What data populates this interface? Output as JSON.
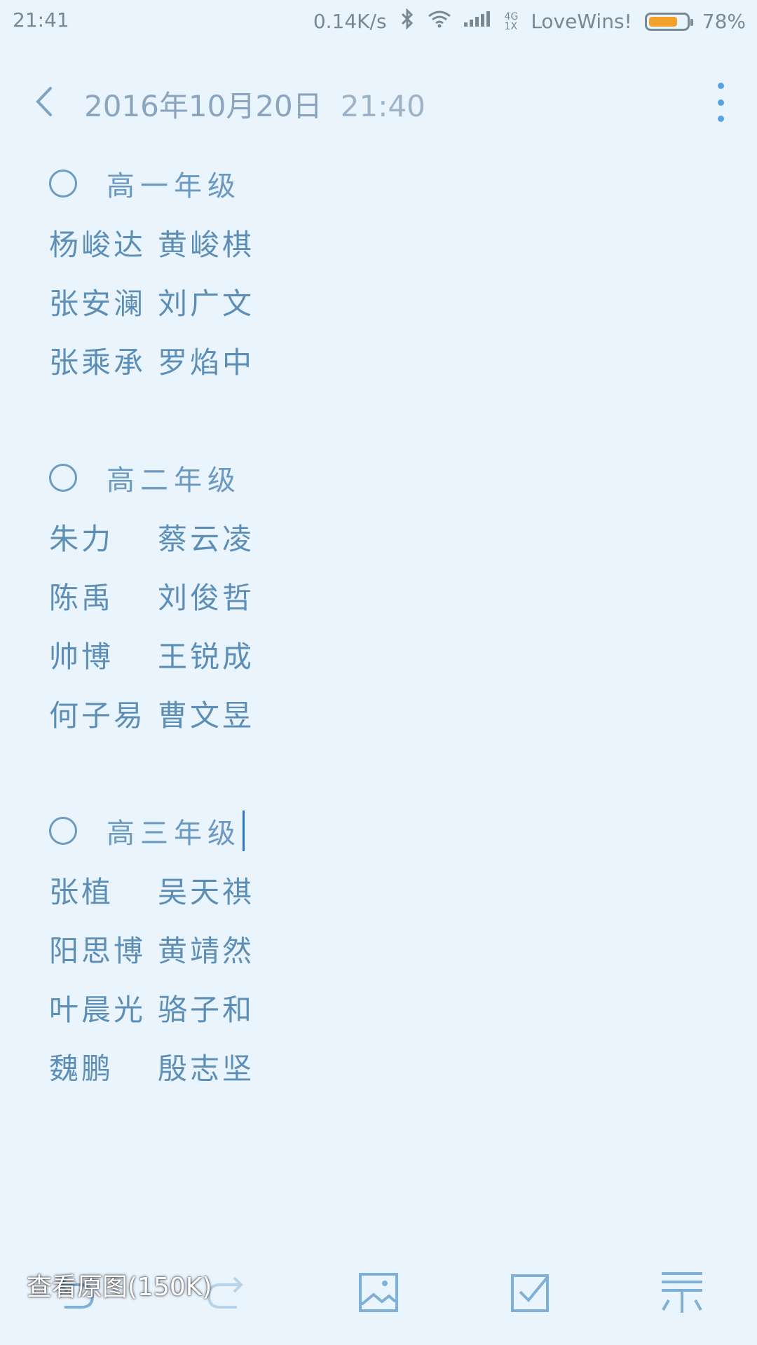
{
  "status_bar": {
    "time": "21:41",
    "speed": "0.14K/s",
    "network_top": "4G",
    "network_bottom": "1X",
    "carrier": "LoveWins!",
    "battery_percent": "78%",
    "battery_level": 0.78,
    "battery_color": "#f2a12b"
  },
  "header": {
    "date": "2016年10月20日",
    "time": "21:40"
  },
  "sections": [
    {
      "title": "高一年级",
      "rows": [
        [
          "杨峻达",
          "黄峻棋"
        ],
        [
          "张安澜",
          "刘广文"
        ],
        [
          "张乘承",
          "罗焰中"
        ]
      ]
    },
    {
      "title": "高二年级",
      "rows": [
        [
          "朱力",
          "蔡云凌"
        ],
        [
          "陈禹",
          "刘俊哲"
        ],
        [
          "帅博",
          "王锐成"
        ],
        [
          "何子易",
          "曹文昱"
        ]
      ]
    },
    {
      "title": "高三年级",
      "rows": [
        [
          "张植",
          "吴天祺"
        ],
        [
          "阳思博",
          "黄靖然"
        ],
        [
          "叶晨光",
          "骆子和"
        ],
        [
          "魏鹏",
          "殷志坚"
        ]
      ]
    }
  ],
  "overlay": {
    "view_original": "查看原图(150K)"
  },
  "toolbar": {
    "icons": [
      "undo-icon",
      "redo-icon",
      "image-icon",
      "checklist-icon",
      "text-style-icon"
    ]
  },
  "colors": {
    "background": "#eaf4fd",
    "accent": "#5aa3e0",
    "text": "#5d8fb6"
  }
}
